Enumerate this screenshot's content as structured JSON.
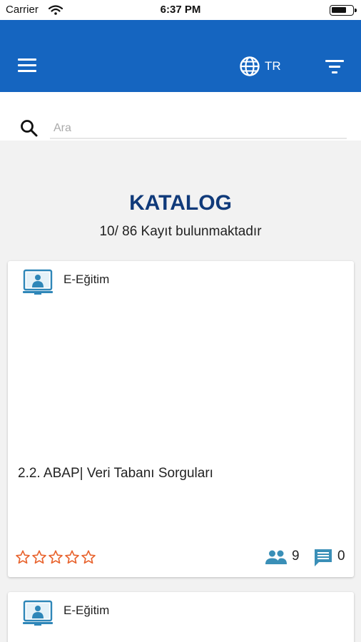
{
  "status_bar": {
    "carrier": "Carrier",
    "time": "6:37 PM",
    "battery_level": 0.75
  },
  "header": {
    "language": "TR"
  },
  "search": {
    "placeholder": "Ara",
    "value": ""
  },
  "catalog": {
    "title": "KATALOG",
    "count_text": "10/ 86 Kayıt bulunmaktadır"
  },
  "cards": [
    {
      "type_label": "E-Eğitim",
      "title": "2.2. ABAP| Veri Tabanı Sorguları",
      "rating": 0,
      "max_rating": 5,
      "participants": "9",
      "comments": "0"
    },
    {
      "type_label": "E-Eğitim"
    }
  ],
  "colors": {
    "app_bar": "#1565c0",
    "title": "#103a7a",
    "star": "#e8622c",
    "footer_icon": "#3a8fb7"
  },
  "icons": [
    "wifi-icon",
    "battery-icon",
    "menu-icon",
    "globe-icon",
    "filter-icon",
    "search-icon",
    "e-learning-icon",
    "star-icon",
    "people-icon",
    "comment-icon"
  ]
}
